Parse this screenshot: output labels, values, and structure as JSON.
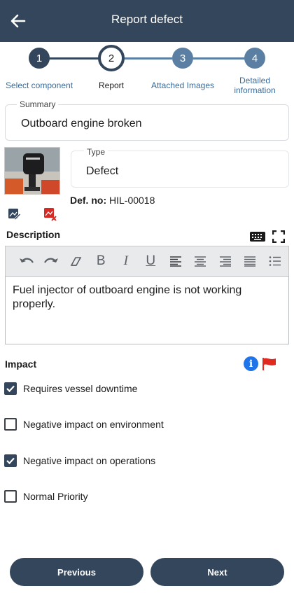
{
  "app_bar": {
    "title": "Report defect",
    "back_icon": "arrow-left-icon"
  },
  "stepper": {
    "steps": [
      {
        "number": "1",
        "label": "Select component",
        "state": "done"
      },
      {
        "number": "2",
        "label": "Report",
        "state": "current"
      },
      {
        "number": "3",
        "label": "Attached Images",
        "state": "todo"
      },
      {
        "number": "4",
        "label": "Detailed information",
        "state": "todo"
      }
    ]
  },
  "summary": {
    "caption": "Summary",
    "value": "Outboard engine broken"
  },
  "type_field": {
    "caption": "Type",
    "value": "Defect"
  },
  "image": {
    "edit_icon": "edit-image-icon",
    "delete_icon": "delete-image-icon"
  },
  "defect_number": {
    "label": "Def. no:",
    "value": "HIL-00018"
  },
  "description": {
    "label": "Description",
    "keyboard_icon": "keyboard-icon",
    "fullscreen_icon": "fullscreen-icon",
    "text": "Fuel injector of outboard engine is not working properly.",
    "toolbar": [
      "undo",
      "redo",
      "clear-format",
      "B",
      "I",
      "U",
      "align-left",
      "align-center",
      "align-right",
      "justify",
      "bulleted-list"
    ]
  },
  "impact": {
    "label": "Impact",
    "info_icon": "info-icon",
    "flag_icon": "red-flag-icon",
    "options": [
      {
        "label": "Requires vessel downtime",
        "checked": true
      },
      {
        "label": "Negative impact on environment",
        "checked": false
      },
      {
        "label": "Negative impact on operations",
        "checked": true
      },
      {
        "label": "Normal Priority",
        "checked": false
      }
    ]
  },
  "footer": {
    "previous_label": "Previous",
    "next_label": "Next"
  },
  "colors": {
    "primary": "#34465c",
    "step_todo": "#5a7fa3",
    "link": "#3a6a98",
    "info": "#1e74e8",
    "flag": "#e02a1f"
  }
}
